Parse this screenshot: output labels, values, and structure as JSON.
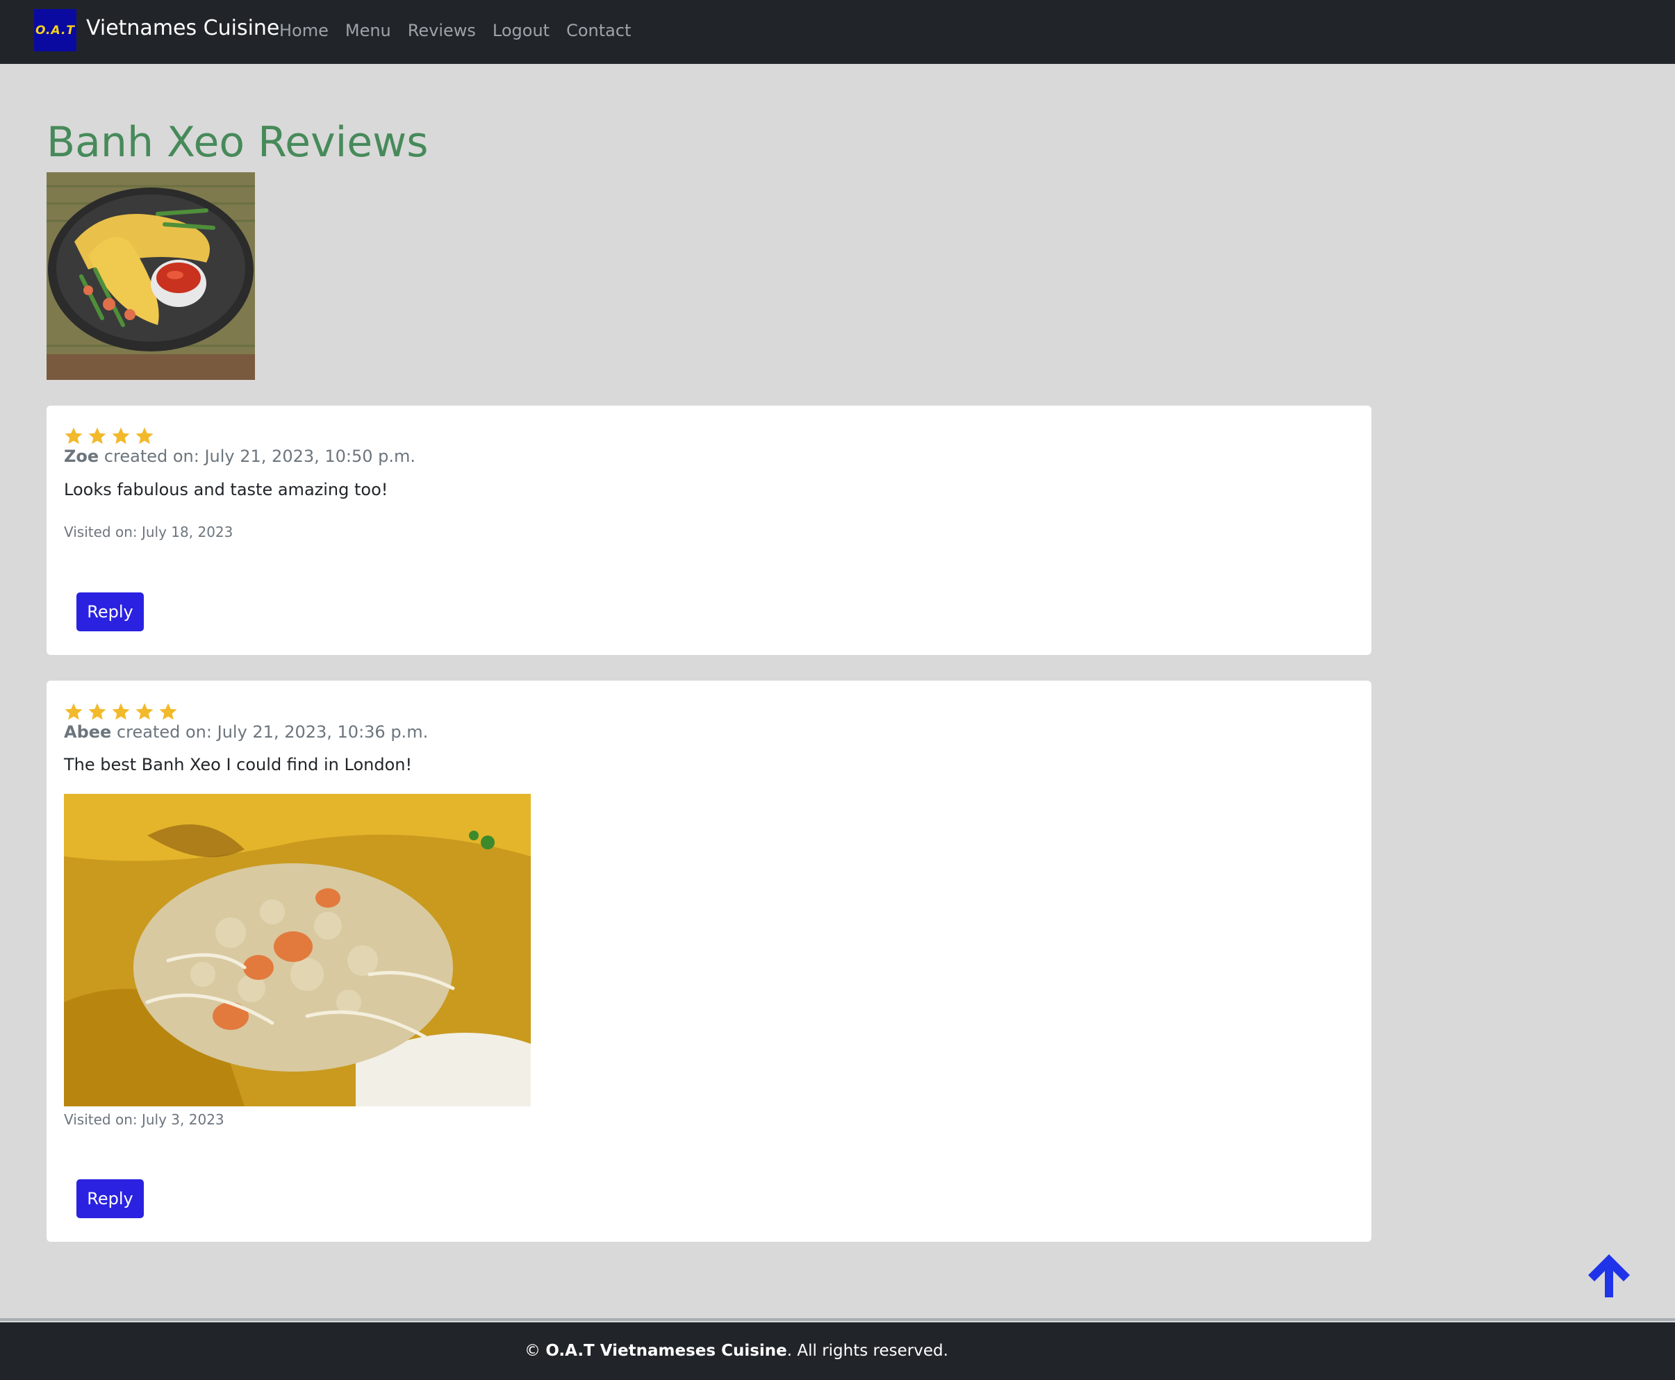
{
  "navbar": {
    "logo_text": "O.A.T",
    "brand": "Vietnames Cuisine",
    "links": [
      "Home",
      "Menu",
      "Reviews",
      "Logout",
      "Contact"
    ]
  },
  "page": {
    "title": "Banh Xeo Reviews"
  },
  "reviews": [
    {
      "rating": 4,
      "author": "Zoe",
      "created": "created on: July 21, 2023, 10:50 p.m.",
      "comment": "Looks fabulous and taste amazing too!",
      "visited": "Visited on: July 18, 2023",
      "reply_label": "Reply"
    },
    {
      "rating": 5,
      "author": "Abee",
      "created": "created on: July 21, 2023, 10:36 p.m.",
      "comment": "The best Banh Xeo I could find in London!",
      "visited": "Visited on: July 3, 2023",
      "reply_label": "Reply"
    }
  ],
  "footer": {
    "copyright_symbol": "©",
    "company": "O.A.T Vietnameses Cuisine",
    "suffix": ". All rights reserved."
  },
  "colors": {
    "navbar_bg": "#212529",
    "page_bg": "#d9d9d9",
    "title_green": "#478a5a",
    "star_gold": "#f2b92b",
    "reply_blue": "#2a22e0",
    "scroll_top_blue": "#1f33e8"
  },
  "icons": {
    "star": "star-icon",
    "scroll_top": "arrow-up-icon"
  }
}
